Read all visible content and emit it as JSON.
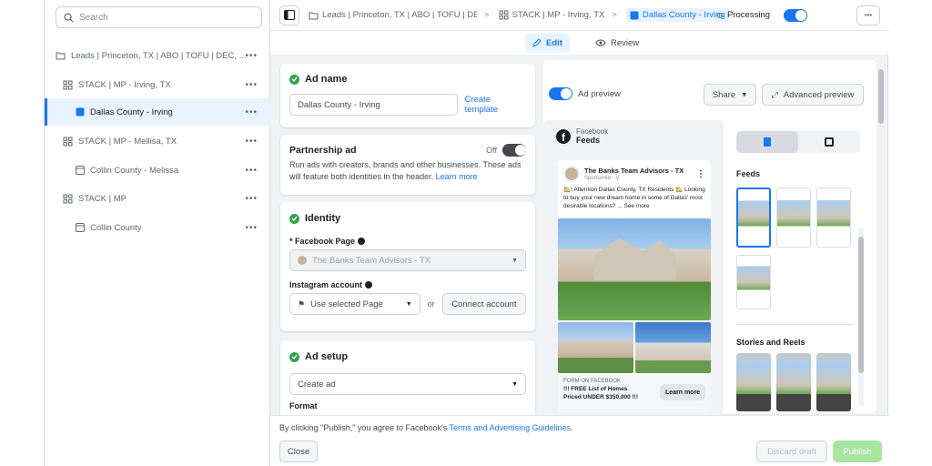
{
  "sidebar": {
    "search_placeholder": "Search",
    "items": [
      {
        "label": "Leads | Princeton, TX | ABO | TOFU | DEC, ..."
      },
      {
        "label": "STACK | MP - Irving, TX"
      },
      {
        "label": "Dallas County - Irving"
      },
      {
        "label": "STACK | MP - Mellisa, TX"
      },
      {
        "label": "Collin County - Melissa"
      },
      {
        "label": "STACK | MP"
      },
      {
        "label": "Collin County"
      }
    ],
    "more_glyph": "•••"
  },
  "topbar": {
    "crumb_campaign": "Leads | Princeton, TX | ABO | TOFU | DEC, ...",
    "crumb_adset": "STACK | MP - Irving, TX",
    "crumb_ad": "Dallas County - Irving",
    "separator": ">",
    "status": "Processing",
    "more_glyph": "•••"
  },
  "modes": {
    "edit": "Edit",
    "review": "Review"
  },
  "ad_name": {
    "heading": "Ad name",
    "value": "Dallas County - Irving",
    "template_link": "Create template"
  },
  "partnership": {
    "heading": "Partnership ad",
    "toggle_state": "Off",
    "description": "Run ads with creators, brands and other businesses. These ads will feature both identities in the header.",
    "learn_more": "Learn more"
  },
  "identity": {
    "heading": "Identity",
    "fb_page_label": "* Facebook Page",
    "fb_page_value": "The Banks Team Advisors - TX",
    "ig_label": "Instagram account",
    "ig_value": "Use selected Page",
    "or_text": "or",
    "connect_button": "Connect account"
  },
  "ad_setup": {
    "heading": "Ad setup",
    "select_value": "Create ad",
    "format_label": "Format"
  },
  "preview": {
    "toggle_label": "Ad preview",
    "share_button": "Share",
    "advanced_button": "Advanced preview",
    "platform": "Facebook",
    "placement": "Feeds",
    "page_name": "The Banks Team Advisors - TX",
    "sponsored": "Sponsored · ⚲",
    "post_text": "🏡! Attention Dallas County, TX Residents 🏡 Looking to buy your new dream home in some of Dallas' most desirable locations? ... See more",
    "cta_source": "FORM ON FACEBOOK",
    "cta_title_1": "!!! FREE List of Homes",
    "cta_title_2": "Priced UNDER $350,000 !!!",
    "cta_button": "Learn more",
    "feeds_heading": "Feeds",
    "stories_heading": "Stories and Reels"
  },
  "footer": {
    "notice_prefix": "By clicking \"Publish,\" you agree to Facebook's",
    "notice_link": "Terms and Advertising Guidelines",
    "close_button": "Close",
    "discard_button": "Discard draft",
    "publish_button": "Publish"
  },
  "colors": {
    "accent": "#1877f2",
    "success": "#2ea44f",
    "publish": "#a8e6a1"
  }
}
